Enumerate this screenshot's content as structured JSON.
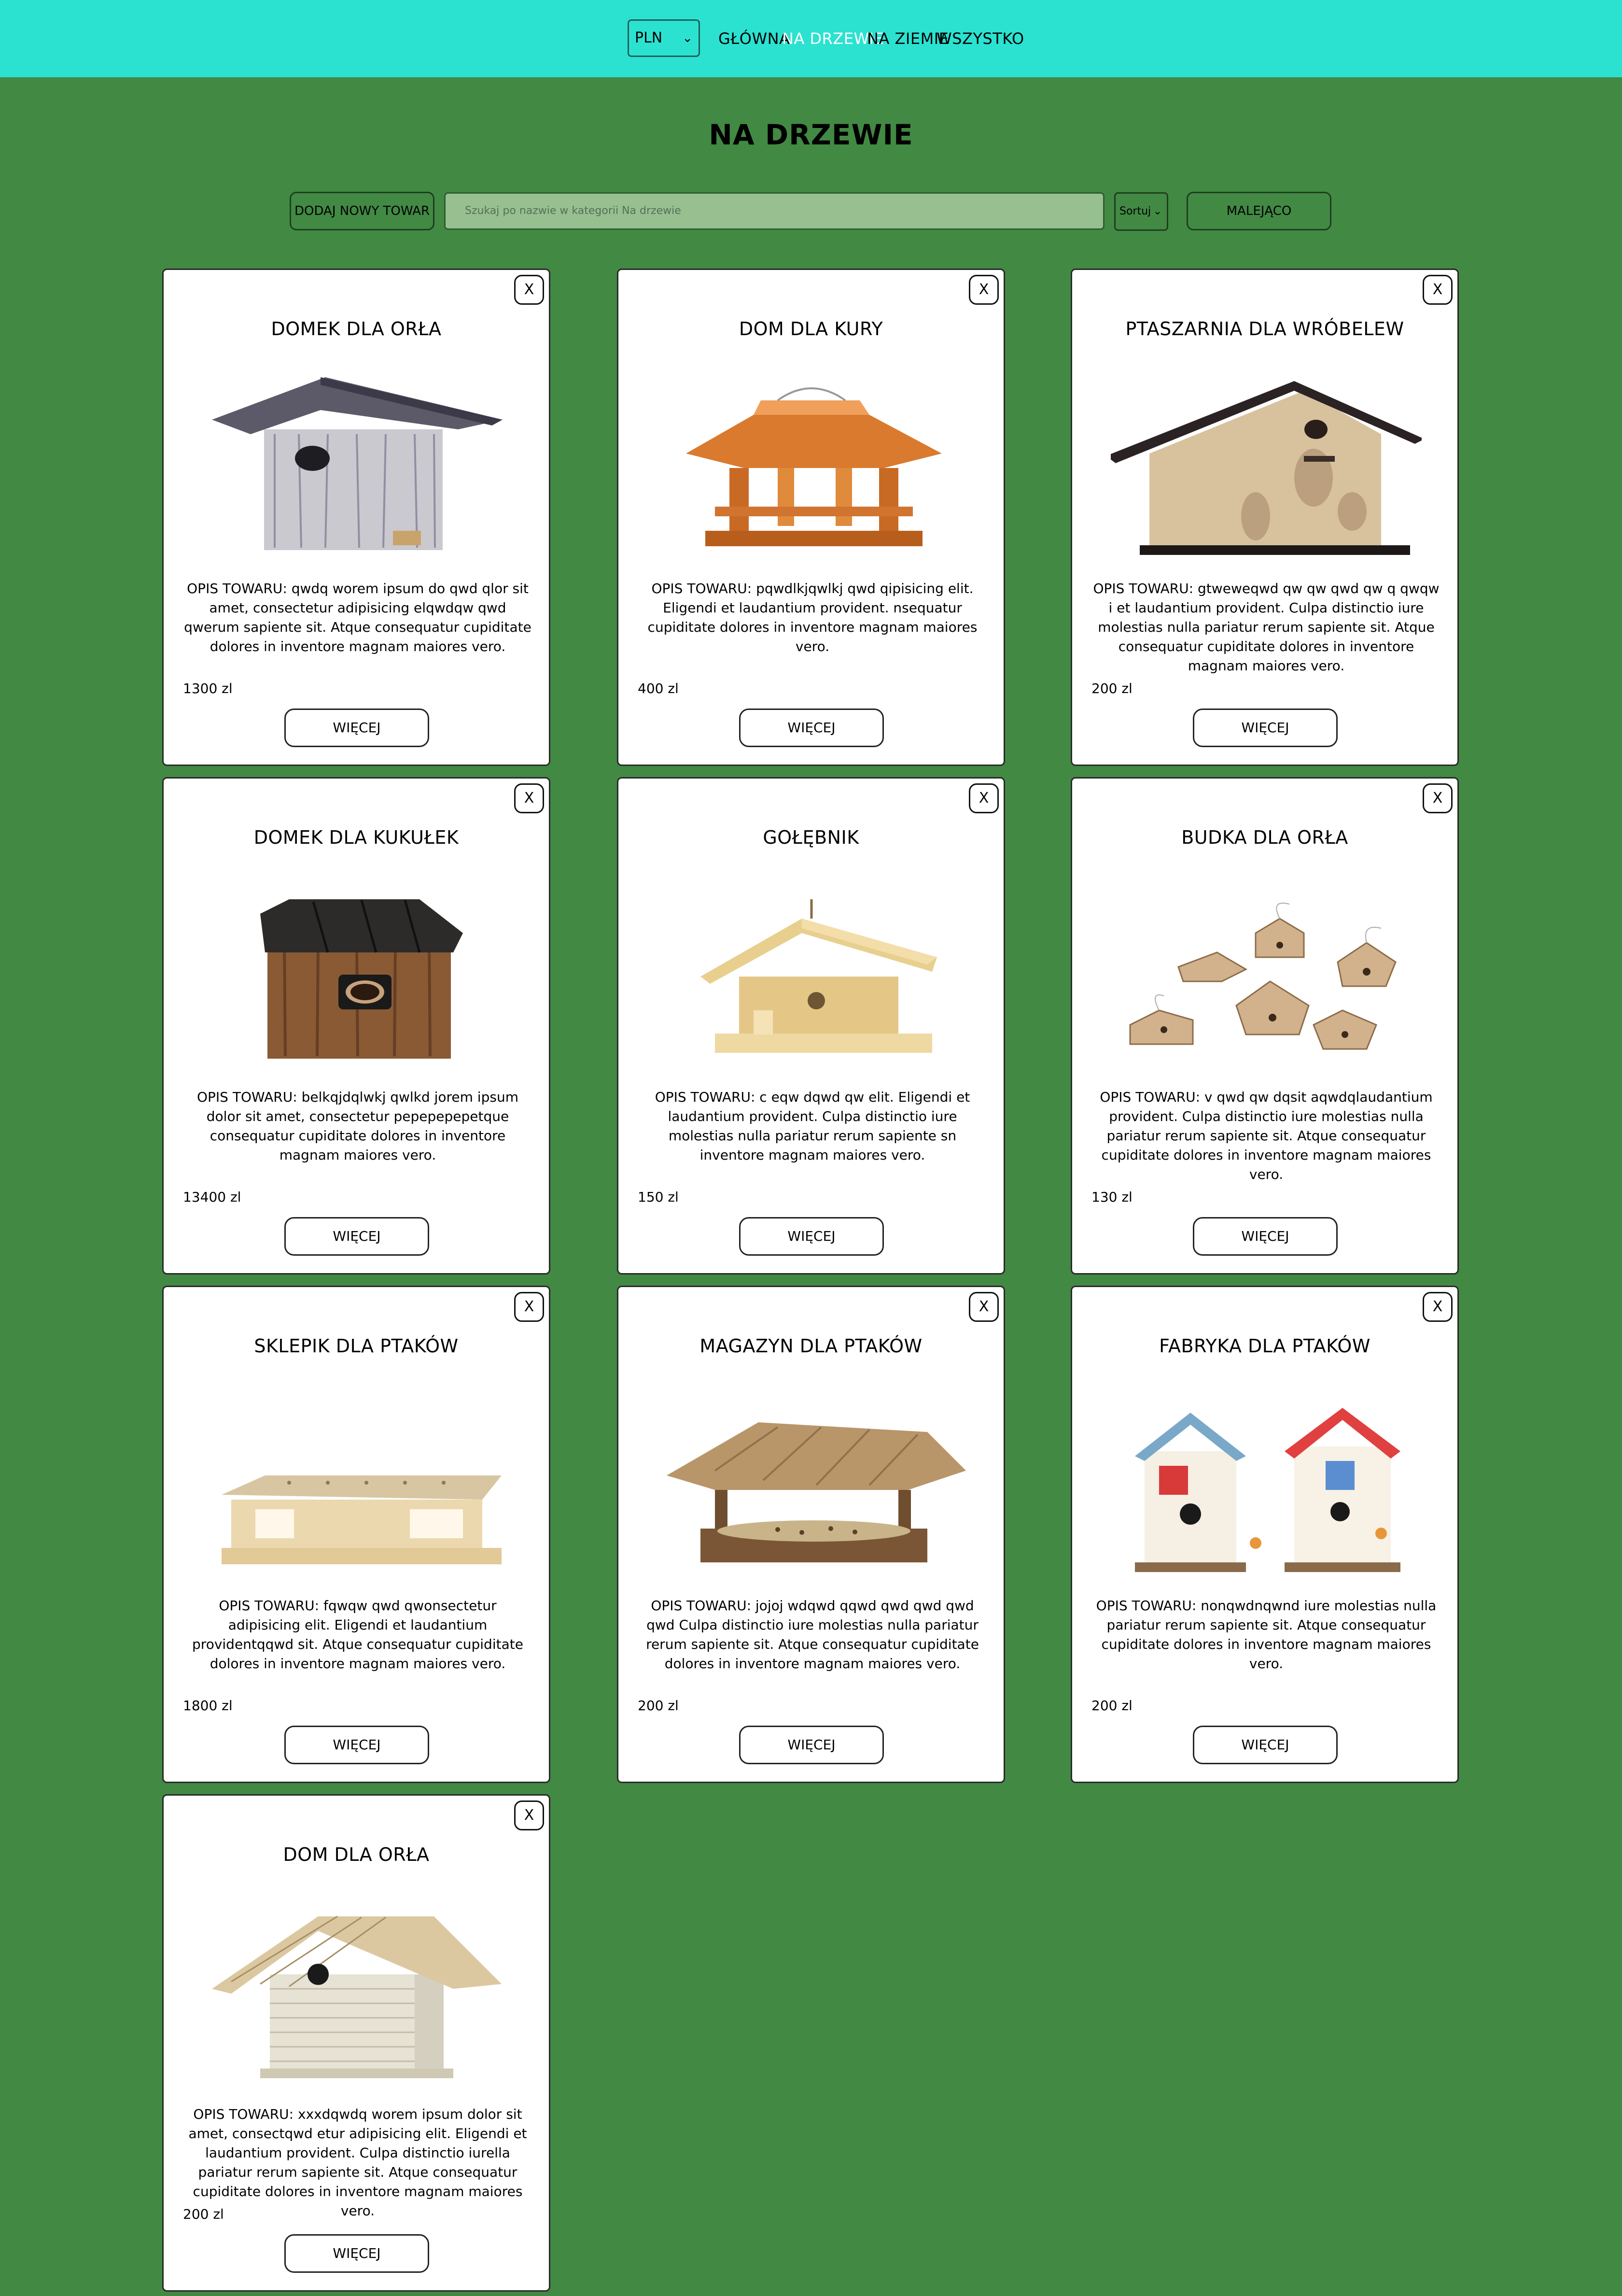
{
  "nav": {
    "currency": "PLN",
    "links": [
      "GŁÓWNA",
      "NA DRZEWIE",
      "NA ZIEMIE",
      "WSZYSTKO"
    ],
    "active": "NA DRZEWIE"
  },
  "page": {
    "title": "NA DRZEWIE"
  },
  "toolbar": {
    "add_label": "DODAJ NOWY TOWAR",
    "search_placeholder": "Szukaj po nazwie w kategorii Na drzewie",
    "sort_label": "Sortuj",
    "order_label": "MALEJĄCO"
  },
  "card_labels": {
    "close": "X",
    "more": "WIĘCEJ"
  },
  "colors": {
    "header_bg": "#2be2d1",
    "page_bg": "#428944",
    "active_nav": "#ffffff"
  },
  "products": [
    {
      "name": "DOMEK DLA ORŁA",
      "description": "OPIS TOWARU: qwdq worem ipsum do qwd qlor sit amet, consectetur adipisicing elqwdqw qwd qwerum sapiente sit. Atque consequatur cupiditate dolores in inventore magnam maiores vero.",
      "price": "1300 zl",
      "image": "birdhouse-grey-icon"
    },
    {
      "name": "DOM DLA KURY",
      "description": "OPIS TOWARU: pqwdlkjqwlkj qwd qipisicing elit. Eligendi et laudantium provident. nsequatur cupiditate dolores in inventore magnam maiores vero.",
      "price": "400 zl",
      "image": "bird-feeder-orange-icon"
    },
    {
      "name": "PTASZARNIA DLA WRÓBELEW",
      "description": "OPIS TOWARU: gtweweqwd qw qw qwd qw q qwqw i et laudantium provident. Culpa distinctio iure molestias nulla pariatur rerum sapiente sit. Atque consequatur cupiditate dolores in inventore magnam maiores vero.",
      "price": "200 zl",
      "image": "birdhouse-wide-icon"
    },
    {
      "name": "DOMEK DLA KUKUŁEK",
      "description": "OPIS TOWARU: belkqjdqlwkj qwlkd jorem ipsum dolor sit amet, consectetur pepepepepetque consequatur cupiditate dolores in inventore magnam maiores vero.",
      "price": "13400 zl",
      "image": "birdhouse-brown-icon"
    },
    {
      "name": "GOŁĘBNIK",
      "description": "OPIS TOWARU: c eqw dqwd qw elit. Eligendi et laudantium provident. Culpa distinctio iure molestias nulla pariatur rerum sapiente sn inventore magnam maiores vero.",
      "price": "150 zl",
      "image": "bird-feeder-pine-icon"
    },
    {
      "name": "BUDKA DLA ORŁA",
      "description": "OPIS TOWARU: v qwd qw dqsit aqwdqlaudantium provident. Culpa distinctio iure molestias nulla pariatur rerum sapiente sit. Atque consequatur cupiditate dolores in inventore magnam maiores vero.",
      "price": "130 zl",
      "image": "birdhouse-set-icon"
    },
    {
      "name": "SKLEPIK DLA PTAKÓW",
      "description": "OPIS TOWARU: fqwqw qwd qwonsectetur adipisicing elit. Eligendi et laudantium providentqqwd sit. Atque consequatur cupiditate dolores in inventore magnam maiores vero.",
      "price": "1800 zl",
      "image": "bird-feeder-open-icon"
    },
    {
      "name": "MAGAZYN DLA PTAKÓW",
      "description": "OPIS TOWARU: jojoj wdqwd qqwd qwd qwd qwd qwd Culpa distinctio iure molestias nulla pariatur rerum sapiente sit. Atque consequatur cupiditate dolores in inventore magnam maiores vero.",
      "price": "200 zl",
      "image": "bird-feeder-seeds-icon"
    },
    {
      "name": "FABRYKA DLA PTAKÓW",
      "description": "OPIS TOWARU: nonqwdnqwnd iure molestias nulla pariatur rerum sapiente sit. Atque consequatur cupiditate dolores in inventore magnam maiores vero.",
      "price": "200 zl",
      "image": "birdhouse-painted-icon"
    },
    {
      "name": "DOM DLA ORŁA",
      "description": "OPIS TOWARU: xxxdqwdq worem ipsum dolor sit amet, consectqwd etur adipisicing elit. Eligendi et laudantium provident. Culpa distinctio iurella pariatur rerum sapiente sit. Atque consequatur cupiditate dolores in inventore magnam maiores vero.",
      "price": "200 zl",
      "image": "birdhouse-white-icon"
    }
  ]
}
